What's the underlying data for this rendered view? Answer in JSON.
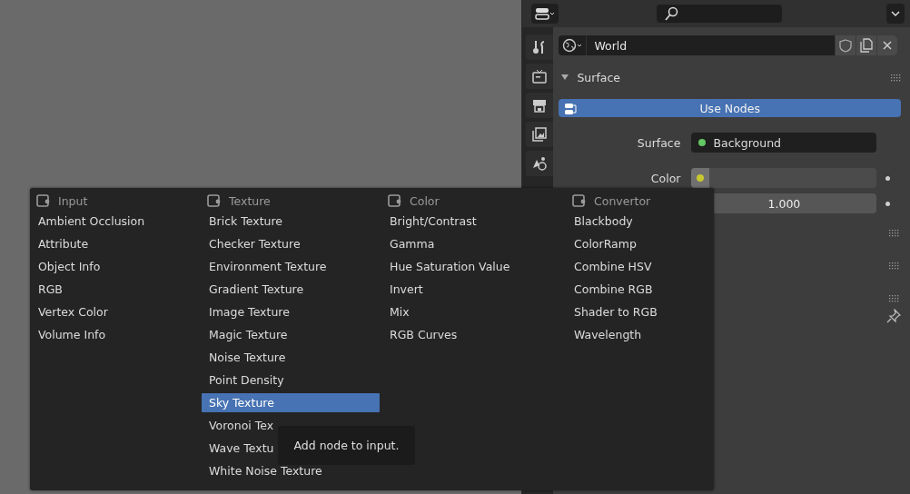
{
  "world": {
    "name": "World"
  },
  "surface_panel": {
    "title": "Surface",
    "expanded": true
  },
  "use_nodes": {
    "label": "Use Nodes",
    "on": true
  },
  "properties": [
    {
      "kind": "link",
      "label": "Surface",
      "value": "Background",
      "color": "#63c763"
    },
    {
      "kind": "color",
      "label": "Color",
      "color": "#c7c72e"
    },
    {
      "kind": "number",
      "value": "1.000"
    }
  ],
  "menu": {
    "columns": [
      {
        "title": "Input",
        "items": [
          {
            "label": "Ambient Occlusion",
            "selected": false
          },
          {
            "label": "Attribute",
            "selected": false
          },
          {
            "label": "Object Info",
            "selected": false
          },
          {
            "label": "RGB",
            "selected": false
          },
          {
            "label": "Vertex Color",
            "selected": false
          },
          {
            "label": "Volume Info",
            "selected": false
          }
        ]
      },
      {
        "title": "Texture",
        "items": [
          {
            "label": "Brick Texture",
            "selected": false
          },
          {
            "label": "Checker Texture",
            "selected": false
          },
          {
            "label": "Environment Texture",
            "selected": false
          },
          {
            "label": "Gradient Texture",
            "selected": false
          },
          {
            "label": "Image Texture",
            "selected": false
          },
          {
            "label": "Magic Texture",
            "selected": false
          },
          {
            "label": "Noise Texture",
            "selected": false
          },
          {
            "label": "Point Density",
            "selected": false
          },
          {
            "label": "Sky Texture",
            "selected": true
          },
          {
            "label": "Voronoi Tex",
            "selected": false
          },
          {
            "label": "Wave Textu",
            "selected": false
          },
          {
            "label": "White Noise Texture",
            "selected": false
          }
        ]
      },
      {
        "title": "Color",
        "items": [
          {
            "label": "Bright/Contrast",
            "selected": false
          },
          {
            "label": "Gamma",
            "selected": false
          },
          {
            "label": "Hue Saturation Value",
            "selected": false
          },
          {
            "label": "Invert",
            "selected": false
          },
          {
            "label": "Mix",
            "selected": false
          },
          {
            "label": "RGB Curves",
            "selected": false
          }
        ]
      },
      {
        "title": "Convertor",
        "items": [
          {
            "label": "Blackbody",
            "selected": false
          },
          {
            "label": "ColorRamp",
            "selected": false
          },
          {
            "label": "Combine HSV",
            "selected": false
          },
          {
            "label": "Combine RGB",
            "selected": false
          },
          {
            "label": "Shader to RGB",
            "selected": false
          },
          {
            "label": "Wavelength",
            "selected": false
          }
        ]
      }
    ]
  },
  "tooltip": {
    "text": "Add node to input."
  }
}
